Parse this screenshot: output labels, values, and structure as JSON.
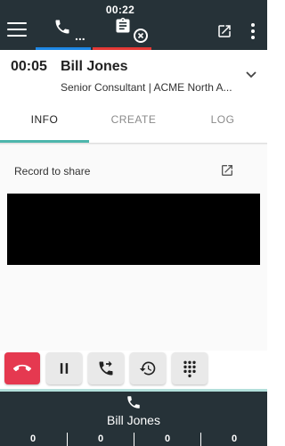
{
  "header": {
    "timer": "00:22",
    "phone_tab_dots": "...",
    "colors": {
      "bar": "#263238",
      "phone_underline": "#1e88e5",
      "task_underline": "#e53935"
    },
    "icons": [
      "menu-icon",
      "phone-icon",
      "clipboard-icon",
      "close-circle-icon",
      "popout-icon",
      "more-vert-icon"
    ]
  },
  "contact": {
    "duration": "00:05",
    "name": "Bill Jones",
    "subtitle": "Senior Consultant | ACME North A..."
  },
  "tabs": {
    "items": [
      {
        "label": "INFO",
        "active": true
      },
      {
        "label": "CREATE",
        "active": false
      },
      {
        "label": "LOG",
        "active": false
      }
    ],
    "accent": "#4db6ac"
  },
  "content": {
    "record_label": "Record to share"
  },
  "actions": {
    "end_color": "#e53950",
    "icons": [
      "end-call-icon",
      "pause-icon",
      "transfer-call-icon",
      "history-icon",
      "dialpad-icon"
    ]
  },
  "bottom": {
    "name": "Bill Jones",
    "counters": [
      "0",
      "0",
      "0",
      "0"
    ]
  }
}
